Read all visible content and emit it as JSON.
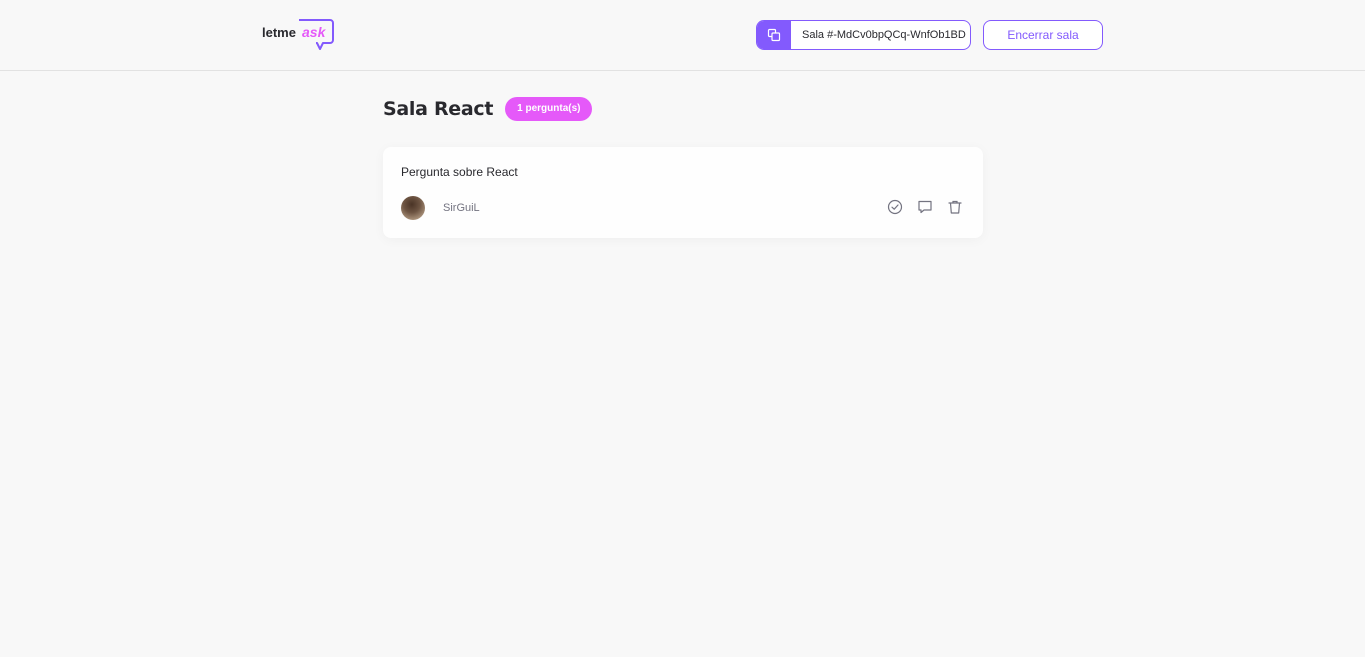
{
  "header": {
    "logo_text_plain": "letme",
    "logo_text_highlight": "ask",
    "room_code_label": "Sala #-MdCv0bpQCq-WnfOb1BD",
    "end_room_label": "Encerrar sala"
  },
  "room": {
    "title": "Sala React",
    "question_count_badge": "1 pergunta(s)"
  },
  "questions": [
    {
      "content": "Pergunta sobre React",
      "author": "SirGuiL"
    }
  ],
  "colors": {
    "brand_purple": "#835afd",
    "badge_pink": "#e559f9",
    "background": "#f8f8f8"
  },
  "icons": {
    "copy": "copy-icon",
    "check": "check-icon",
    "answer": "answer-icon",
    "delete": "delete-icon"
  }
}
